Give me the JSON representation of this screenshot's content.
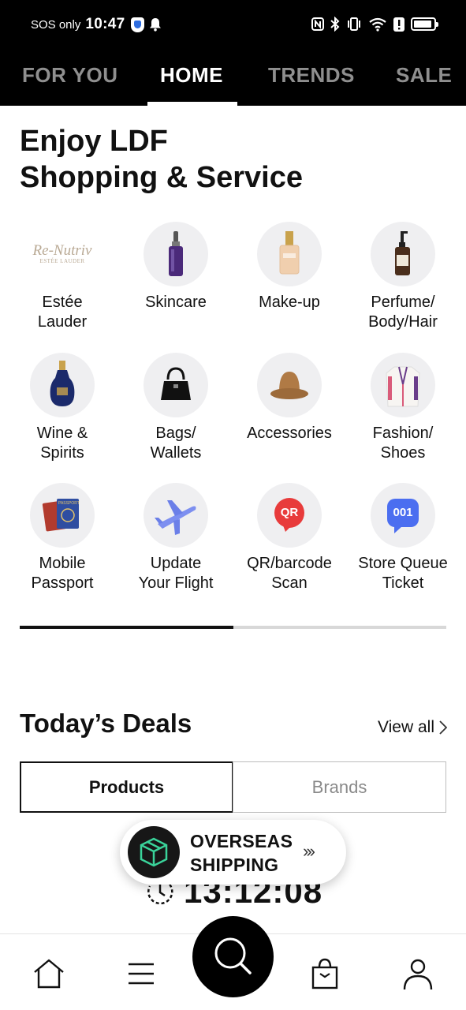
{
  "status_bar": {
    "sos": "SOS only",
    "time": "10:47"
  },
  "top_tabs": {
    "items": [
      "FOR YOU",
      "HOME",
      "TRENDS",
      "SALE"
    ],
    "active": "HOME"
  },
  "hero": {
    "line1": "Enjoy LDF",
    "line2": "Shopping & Service"
  },
  "categories": [
    {
      "label": "Estée\nLauder",
      "logo_main": "Re-Nutriv",
      "logo_sub": "ESTÉE LAUDER"
    },
    {
      "label": "Skincare"
    },
    {
      "label": "Make-up"
    },
    {
      "label": "Perfume/\nBody/Hair"
    },
    {
      "label": "Wine &\nSpirits"
    },
    {
      "label": "Bags/\nWallets"
    },
    {
      "label": "Accessories"
    },
    {
      "label": "Fashion/\nShoes"
    },
    {
      "label": "Mobile\nPassport",
      "icon_text": "PASSPORT"
    },
    {
      "label": "Update\nYour Flight"
    },
    {
      "label": "QR/barcode\nScan",
      "icon_text": "QR"
    },
    {
      "label": "Store Queue\nTicket",
      "icon_text": "001"
    }
  ],
  "carousel": {
    "progress": 0.5
  },
  "deals": {
    "title": "Today’s Deals",
    "view_all": "View all",
    "tabs": [
      "Products",
      "Brands"
    ],
    "active_tab": "Products"
  },
  "overseas": {
    "line1": "OVERSEAS",
    "line2": "SHIPPING",
    "arrows": "›››"
  },
  "timer": "13:12:08",
  "bottom_nav": [
    "home-icon",
    "menu-icon",
    "search-icon",
    "shopping-bag-icon",
    "user-icon"
  ],
  "colors": {
    "header_bg": "#000000",
    "tab_inactive": "#8f8f8f",
    "qr_red": "#e83b3b",
    "queue_blue": "#4b6ef0"
  }
}
